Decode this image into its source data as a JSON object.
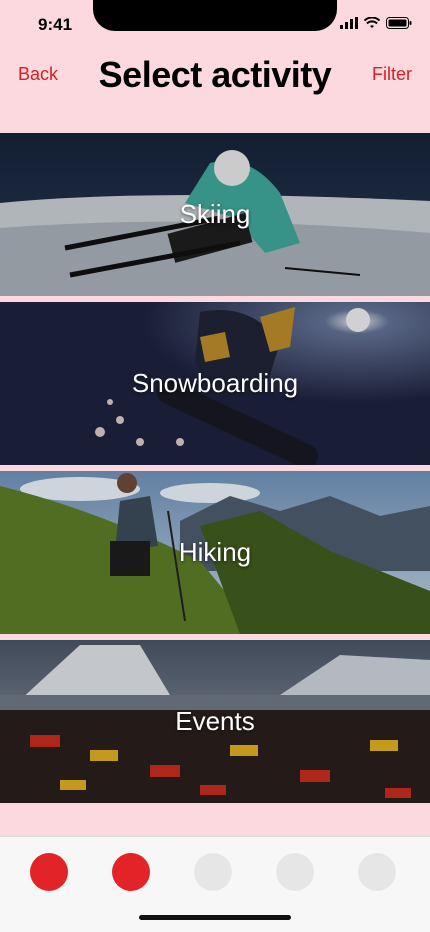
{
  "status": {
    "time": "9:41"
  },
  "header": {
    "back_label": "Back",
    "title": "Select activity",
    "filter_label": "Filter"
  },
  "activities": [
    {
      "label": "Skiing",
      "image": "skier-photo"
    },
    {
      "label": "Snowboarding",
      "image": "snowboarder-photo"
    },
    {
      "label": "Hiking",
      "image": "hiker-photo"
    },
    {
      "label": "Events",
      "image": "crowd-event-photo"
    }
  ],
  "pagination": {
    "total": 5,
    "active": [
      1,
      2
    ]
  },
  "colors": {
    "accent": "#d42025",
    "background": "#fcd9df",
    "inactive_dot": "#e6e6e6"
  }
}
